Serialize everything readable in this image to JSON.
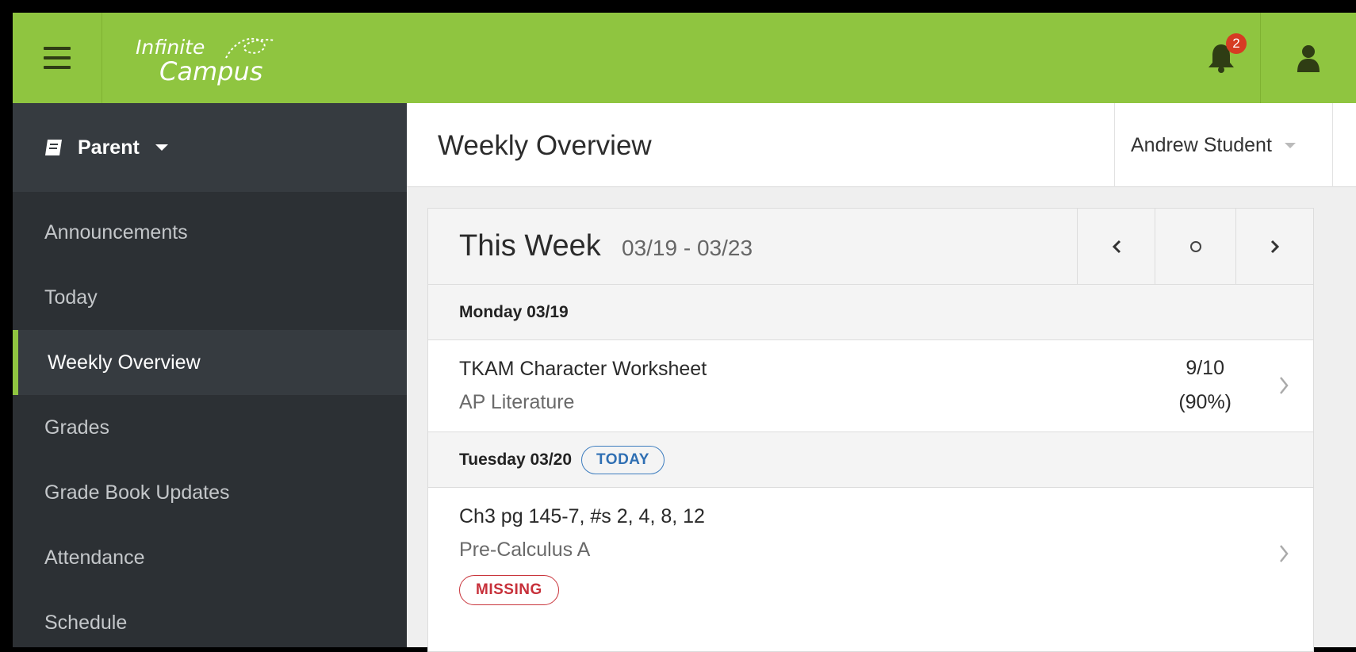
{
  "app": {
    "logo_line1": "Infinite",
    "logo_line2": "Campus",
    "notification_count": "2"
  },
  "sidebar": {
    "role_label": "Parent",
    "items": [
      {
        "label": "Announcements",
        "active": false
      },
      {
        "label": "Today",
        "active": false
      },
      {
        "label": "Weekly Overview",
        "active": true
      },
      {
        "label": "Grades",
        "active": false
      },
      {
        "label": "Grade Book Updates",
        "active": false
      },
      {
        "label": "Attendance",
        "active": false
      },
      {
        "label": "Schedule",
        "active": false
      }
    ]
  },
  "header": {
    "title": "Weekly Overview",
    "student_name": "Andrew Student"
  },
  "week": {
    "title": "This Week",
    "range": "03/19 - 03/23",
    "days": [
      {
        "label": "Monday 03/19",
        "assignments": [
          {
            "name": "TKAM Character Worksheet",
            "course": "AP Literature",
            "score": "9/10",
            "percent": "(90%)"
          }
        ]
      },
      {
        "label": "Tuesday 03/20",
        "badge": "TODAY",
        "assignments": [
          {
            "name": "Ch3 pg 145-7, #s 2, 4, 8, 12",
            "course": "Pre-Calculus A",
            "status": "MISSING"
          }
        ]
      }
    ]
  },
  "colors": {
    "topbar": "#8fc540",
    "sidebar": "#2c3034",
    "accent_active": "#8fc540",
    "today_badge": "#2f6fb3",
    "missing_badge": "#c7303a",
    "notification": "#d63c23"
  }
}
